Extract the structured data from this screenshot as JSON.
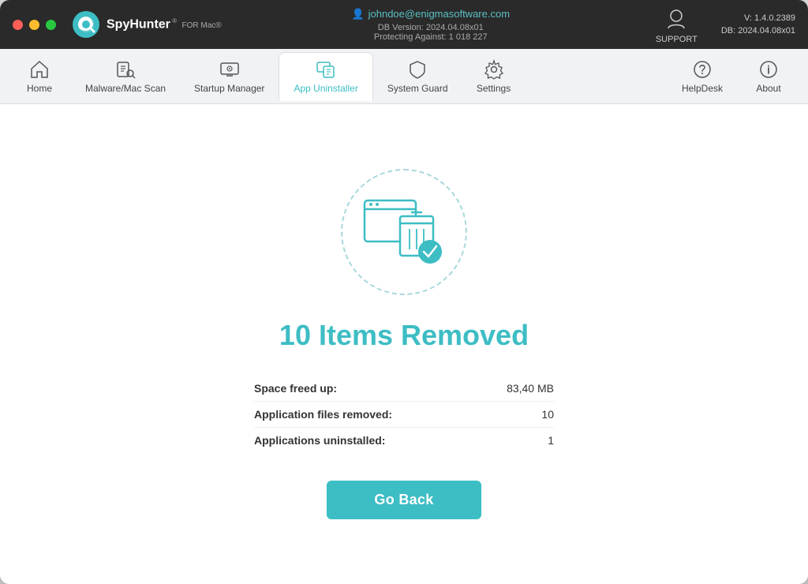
{
  "window": {
    "title": "SpyHunter for Mac"
  },
  "titlebar": {
    "brand_name": "SpyHunter",
    "brand_suffix": "FOR Mac®",
    "user_email": "johndoe@enigmasoftware.com",
    "db_version_label": "DB Version: 2024.04.08x01",
    "protecting_label": "Protecting Against: 1 018 227",
    "support_label": "SUPPORT",
    "version_label": "V: 1.4.0.2389",
    "db_label": "DB:  2024.04.08x01"
  },
  "navbar": {
    "items": [
      {
        "id": "home",
        "label": "Home"
      },
      {
        "id": "malware-scan",
        "label": "Malware/Mac Scan"
      },
      {
        "id": "startup-manager",
        "label": "Startup Manager"
      },
      {
        "id": "app-uninstaller",
        "label": "App Uninstaller"
      },
      {
        "id": "system-guard",
        "label": "System Guard"
      },
      {
        "id": "settings",
        "label": "Settings"
      }
    ],
    "right_items": [
      {
        "id": "helpdesk",
        "label": "HelpDesk"
      },
      {
        "id": "about",
        "label": "About"
      }
    ]
  },
  "main": {
    "result_title": "10 Items Removed",
    "stats": [
      {
        "label": "Space freed up:",
        "value": "83,40 MB"
      },
      {
        "label": "Application files removed:",
        "value": "10"
      },
      {
        "label": "Applications uninstalled:",
        "value": "1"
      }
    ],
    "go_back_label": "Go Back"
  },
  "colors": {
    "teal": "#3dbdc4",
    "dark_teal": "#2a9da4"
  }
}
